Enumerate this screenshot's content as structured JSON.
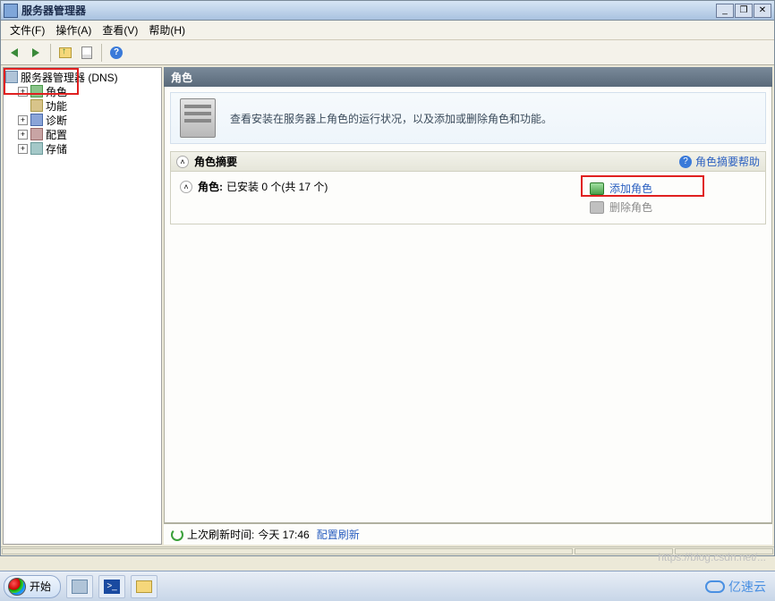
{
  "title": "服务器管理器",
  "menu": {
    "file": "文件(F)",
    "action": "操作(A)",
    "view": "查看(V)",
    "help": "帮助(H)"
  },
  "tree": {
    "root": "服务器管理器 (DNS)",
    "roles": "角色",
    "features": "功能",
    "diagnostics": "诊断",
    "configuration": "配置",
    "storage": "存储"
  },
  "content": {
    "header": "角色",
    "banner_text": "查看安装在服务器上角色的运行状况，以及添加或删除角色和功能。",
    "section_title": "角色摘要",
    "help_link": "角色摘要帮助",
    "roles_label": "角色:",
    "roles_status": "已安装 0 个(共 17 个)",
    "add_roles": "添加角色",
    "remove_roles": "删除角色"
  },
  "status": {
    "prefix": "上次刷新时间:",
    "time": "今天 17:46",
    "refresh_link": "配置刷新"
  },
  "taskbar": {
    "start": "开始"
  },
  "watermark": "https://blog.csdn.net/...",
  "brand": "亿速云"
}
